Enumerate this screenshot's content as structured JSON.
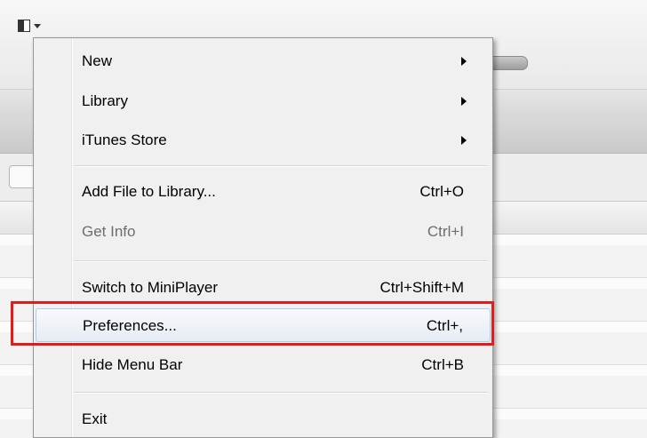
{
  "menu": {
    "items": [
      {
        "label": "New",
        "shortcut": "",
        "submenu": true,
        "enabled": true
      },
      {
        "label": "Library",
        "shortcut": "",
        "submenu": true,
        "enabled": true
      },
      {
        "label": "iTunes Store",
        "shortcut": "",
        "submenu": true,
        "enabled": true
      },
      {
        "label": "Add File to Library...",
        "shortcut": "Ctrl+O",
        "submenu": false,
        "enabled": true
      },
      {
        "label": "Get Info",
        "shortcut": "Ctrl+I",
        "submenu": false,
        "enabled": false
      },
      {
        "label": "Switch to MiniPlayer",
        "shortcut": "Ctrl+Shift+M",
        "submenu": false,
        "enabled": true
      },
      {
        "label": "Preferences...",
        "shortcut": "Ctrl+,",
        "submenu": false,
        "enabled": true,
        "highlighted": true
      },
      {
        "label": "Hide Menu Bar",
        "shortcut": "Ctrl+B",
        "submenu": false,
        "enabled": true
      },
      {
        "label": "Exit",
        "shortcut": "",
        "submenu": false,
        "enabled": true
      }
    ]
  },
  "icons": {
    "menu_button": "window-menu-icon",
    "menu_button_chevron": "chevron-down-icon",
    "submenu_arrow": "submenu-arrow-icon"
  },
  "colors": {
    "highlight_box": "#e31b1b",
    "menu_background": "#f0f0f0",
    "hover_border": "#aecbe8"
  }
}
